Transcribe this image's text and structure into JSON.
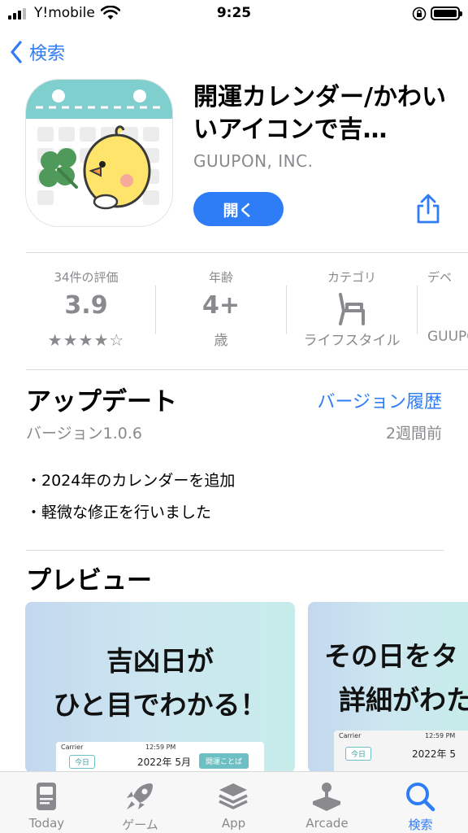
{
  "status_bar": {
    "carrier": "Y!mobile",
    "time": "9:25"
  },
  "nav": {
    "back_label": "検索"
  },
  "app": {
    "title": "開運カレンダー/かわいいアイコンで吉…",
    "developer": "GUUPON, INC.",
    "open_label": "開く"
  },
  "info": {
    "ratings": {
      "label": "34件の評価",
      "value": "3.9",
      "stars": "★★★★☆",
      "rating_fraction": 0.78
    },
    "age": {
      "label": "年齢",
      "value": "4+",
      "sub": "歳"
    },
    "category": {
      "label": "カテゴリ",
      "sub": "ライフスタイル",
      "icon": "chair-icon"
    },
    "developer": {
      "label": "デベ",
      "sub": "GUUPON"
    }
  },
  "update": {
    "title": "アップデート",
    "history_link": "バージョン履歴",
    "version": "バージョン1.0.6",
    "ago": "2週間前",
    "notes": [
      "・2024年のカレンダーを追加",
      "・軽微な修正を行いました"
    ]
  },
  "preview": {
    "title": "プレビュー",
    "shots": [
      {
        "line1": "吉凶日が",
        "line2": "ひと目でわかる！",
        "carrier": "Carrier",
        "time": "12:59 PM",
        "today": "今日",
        "month": "2022年 5月",
        "kotoba": "開運ことば"
      },
      {
        "line1": "その日をタ",
        "line2": "詳細がわた",
        "carrier": "Carrier",
        "time": "12:59 PM",
        "today": "今日",
        "month": "2022年 5"
      }
    ]
  },
  "tabs": [
    {
      "label": "Today",
      "icon": "today-icon"
    },
    {
      "label": "ゲーム",
      "icon": "rocket-icon"
    },
    {
      "label": "App",
      "icon": "apps-stack-icon"
    },
    {
      "label": "Arcade",
      "icon": "joystick-icon"
    },
    {
      "label": "検索",
      "icon": "search-icon",
      "active": true
    }
  ],
  "colors": {
    "accent": "#2f7df6",
    "secondary_text": "#8a8a8e",
    "icon_teal": "#7fcfcf"
  }
}
